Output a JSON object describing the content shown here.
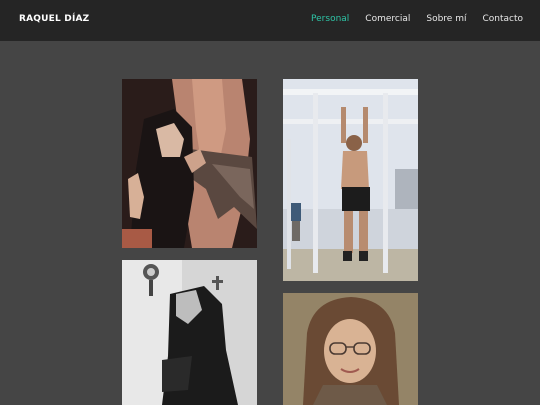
{
  "header": {
    "brand": "RAQUEL DÍAZ",
    "nav": [
      {
        "label": "Personal",
        "active": true
      },
      {
        "label": "Comercial",
        "active": false
      },
      {
        "label": "Sobre mí",
        "active": false
      },
      {
        "label": "Contacto",
        "active": false
      }
    ]
  },
  "colors": {
    "page_bg": "#454545",
    "header_bg": "#252525",
    "accent": "#2ec4a6"
  },
  "gallery": [
    {
      "subject": "nun-embracing-crucifix-photo"
    },
    {
      "subject": "man-hanging-from-bars-photo"
    },
    {
      "subject": "woman-in-black-mourning-photo"
    },
    {
      "subject": "girl-with-glasses-portrait-photo"
    }
  ]
}
